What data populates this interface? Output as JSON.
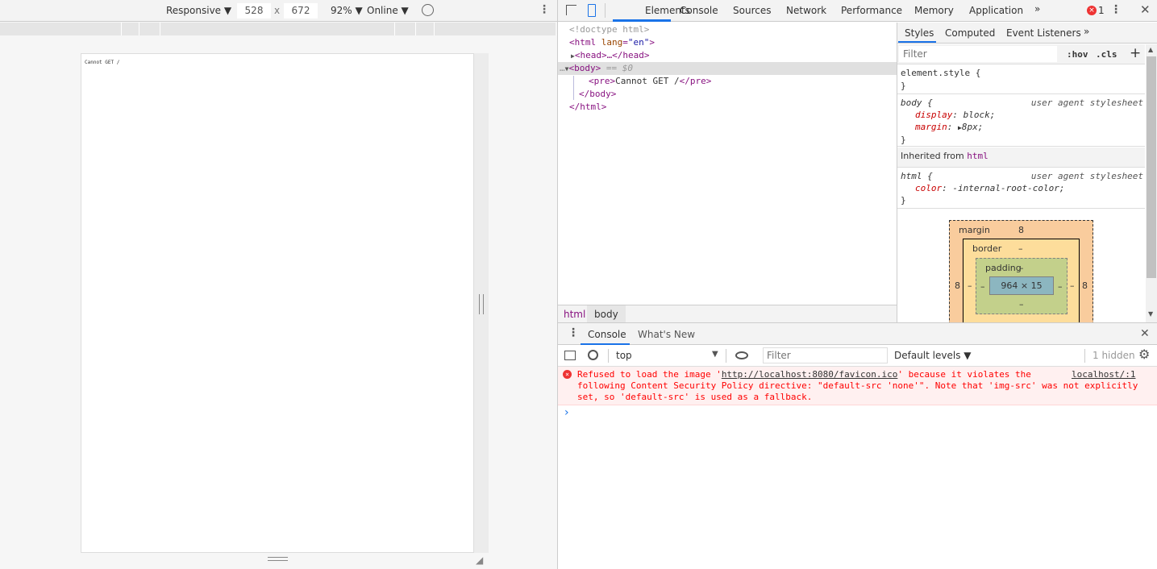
{
  "device_toolbar": {
    "device": "Responsive",
    "width": "528",
    "x": "x",
    "height": "672",
    "zoom": "92%",
    "network": "Online"
  },
  "page": {
    "content": "Cannot GET /"
  },
  "devtools": {
    "tabs": [
      "Elements",
      "Console",
      "Sources",
      "Network",
      "Performance",
      "Memory",
      "Application"
    ],
    "more": "»",
    "error_count": "1",
    "dom": {
      "doctype": "<!doctype html>",
      "html_open": "<html",
      "lang_attr": "lang",
      "lang_val": "\"en\"",
      "head": "<head>…</head>",
      "body": "<body>",
      "body_ref": "== $0",
      "pre_open": "<pre>",
      "pre_text": "Cannot GET /",
      "pre_close": "</pre>",
      "body_close": "</body>",
      "html_close": "</html>"
    },
    "breadcrumb": [
      "html",
      "body"
    ],
    "styles": {
      "tabs": [
        "Styles",
        "Computed",
        "Event Listeners"
      ],
      "filter_placeholder": "Filter",
      "hov": ":hov",
      "cls": ".cls",
      "plus": "+",
      "element_style": "element.style {",
      "close": "}",
      "body_selector": "body {",
      "source": "user agent stylesheet",
      "display_prop": "display",
      "display_val": "block;",
      "margin_prop": "margin",
      "margin_val": "8px;",
      "inherited": "Inherited from",
      "inherited_tag": "html",
      "html_selector": "html {",
      "color_prop": "color",
      "color_val": "-internal-root-color;"
    },
    "box_model": {
      "margin_label": "margin",
      "margin": "8",
      "margin_left": "8",
      "margin_right": "8",
      "border_label": "border",
      "border": "–",
      "padding_label": "padding",
      "padding": "–",
      "content": "964 × 15",
      "dash": "–"
    },
    "drawer": {
      "tabs": [
        "Console",
        "What's New"
      ]
    },
    "console": {
      "context": "top",
      "filter_placeholder": "Filter",
      "levels": "Default levels",
      "hidden": "1 hidden",
      "message": {
        "pre": "Refused to load the image '",
        "link": "http://localhost:8080/favicon.ico",
        "post": "' because it violates the",
        "line2": "following Content Security Policy directive: \"default-src 'none'\". Note that 'img-src' was not explicitly",
        "line3": "set, so 'default-src' is used as a fallback.",
        "source": "localhost/:1"
      },
      "prompt": "›"
    },
    "colors": {
      "accent": "#1a73e8",
      "error": "#ff0000",
      "error_bg": "#fff0f0"
    }
  }
}
